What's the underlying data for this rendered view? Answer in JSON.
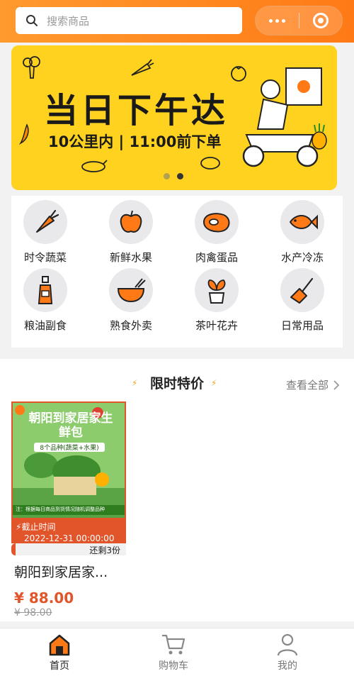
{
  "search": {
    "placeholder": "搜索商品"
  },
  "banner": {
    "headline": "当日下午达",
    "subline": "10公里内 | 11:00前下单",
    "page_count": 2,
    "active_page": 2
  },
  "categories": [
    {
      "label": "时令蔬菜",
      "icon": "carrot-icon"
    },
    {
      "label": "新鲜水果",
      "icon": "apple-icon"
    },
    {
      "label": "肉禽蛋品",
      "icon": "meat-icon"
    },
    {
      "label": "水产冷冻",
      "icon": "fish-icon"
    },
    {
      "label": "粮油副食",
      "icon": "oil-bottle-icon"
    },
    {
      "label": "熟食外卖",
      "icon": "bowl-icon"
    },
    {
      "label": "茶叶花卉",
      "icon": "potted-plant-icon"
    },
    {
      "label": "日常用品",
      "icon": "broom-icon"
    }
  ],
  "flash_sale": {
    "title": "限时特价",
    "view_all": "查看全部",
    "product": {
      "image_title": "朝阳到家居家生鲜包",
      "image_sub": "8个品种(蔬菜+水果)",
      "image_note": "注：根据每日商品到货情况随机调整品种",
      "deadline_label": "截止时间",
      "deadline": "2022-12-31 00:00:00",
      "stock": "还剩3份",
      "name": "朝阳到家居家...",
      "price": "¥ 88.00",
      "original_price": "¥ 98.00"
    }
  },
  "tabbar": {
    "items": [
      {
        "label": "首页",
        "icon": "home-icon",
        "active": true
      },
      {
        "label": "购物车",
        "icon": "cart-icon",
        "active": false
      },
      {
        "label": "我的",
        "icon": "user-icon",
        "active": false
      }
    ]
  },
  "colors": {
    "accent": "#ff7a16",
    "banner": "#ffd21f",
    "sale": "#e2542a"
  }
}
